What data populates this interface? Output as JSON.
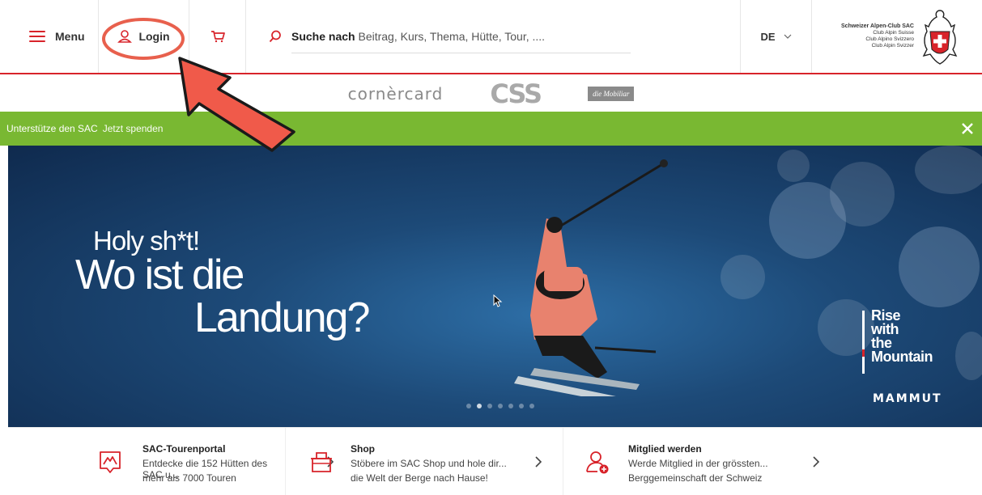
{
  "header": {
    "menu_label": "Menu",
    "login_label": "Login",
    "search_bold": "Suche nach",
    "search_rest": " Beitrag, Kurs, Thema, Hütte, Tour, ....",
    "language": "DE",
    "logo_lines": [
      "Schweizer Alpen-Club SAC",
      "Club Alpin Suisse",
      "Club Alpino Svizzero",
      "Club Alpin Svizzer"
    ]
  },
  "sponsors": [
    "cornèrcard",
    "CSS",
    "die Mobiliar"
  ],
  "donate": {
    "text": "Unterstütze den SAC",
    "link": "Jetzt spenden"
  },
  "hero": {
    "line1": "Holy sh*t!",
    "line2": "Wo ist die",
    "line3": "Landung?",
    "side_lines": [
      "Rise",
      "with",
      "the",
      "Mountain"
    ],
    "brand": "MAMMUT",
    "slider": {
      "count": 7,
      "active": 2
    }
  },
  "cards": [
    {
      "title": "SAC-Tourenportal",
      "line1": "Entdecke die 152 Hütten des SAC u...",
      "line2": "mehr als 7000 Touren",
      "icon": "map-pin-mountain-icon"
    },
    {
      "title": "Shop",
      "line1": "Stöbere im SAC Shop und hole dir...",
      "line2": "die Welt der Berge nach Hause!",
      "icon": "shop-basket-icon"
    },
    {
      "title": "Mitglied werden",
      "line1": "Werde Mitglied in der grössten...",
      "line2": "Berggemeinschaft der Schweiz",
      "icon": "add-member-icon"
    }
  ],
  "colors": {
    "accent": "#d8232a",
    "donate_bg": "#79b832",
    "annotation": "#f05a4a"
  }
}
